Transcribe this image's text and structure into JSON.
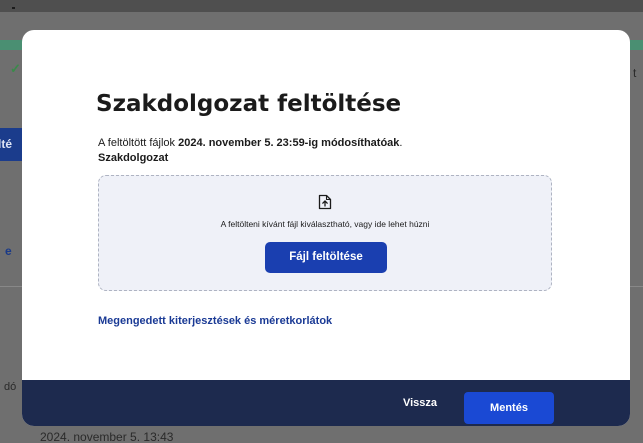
{
  "background": {
    "left_button_fragment": "lté",
    "right_text_fragment": "t",
    "left_link_fragment": "e",
    "left_text_fragment": "dó",
    "bottom_date_text": "2024. november 5. 13:43"
  },
  "modal": {
    "title": "Szakdolgozat feltöltése",
    "info_prefix": "A feltöltött fájlok ",
    "info_deadline": "2024. november 5. 23:59-ig módosíthatóak",
    "info_suffix": ".",
    "field_label": "Szakdolgozat",
    "dropzone": {
      "icon": "file-upload-icon",
      "hint": "A feltölteni kívánt fájl kiválasztható, vagy ide lehet húzni",
      "upload_button_label": "Fájl feltöltése"
    },
    "extensions_link_label": "Megengedett kiterjesztések és méretkorlátok",
    "footer": {
      "back_label": "Vissza",
      "save_label": "Mentés"
    }
  },
  "colors": {
    "primary": "#1a3fb0",
    "footer_background": "#1d2a4e",
    "link": "#1a3a95",
    "dropzone_background": "#eff1f8"
  }
}
